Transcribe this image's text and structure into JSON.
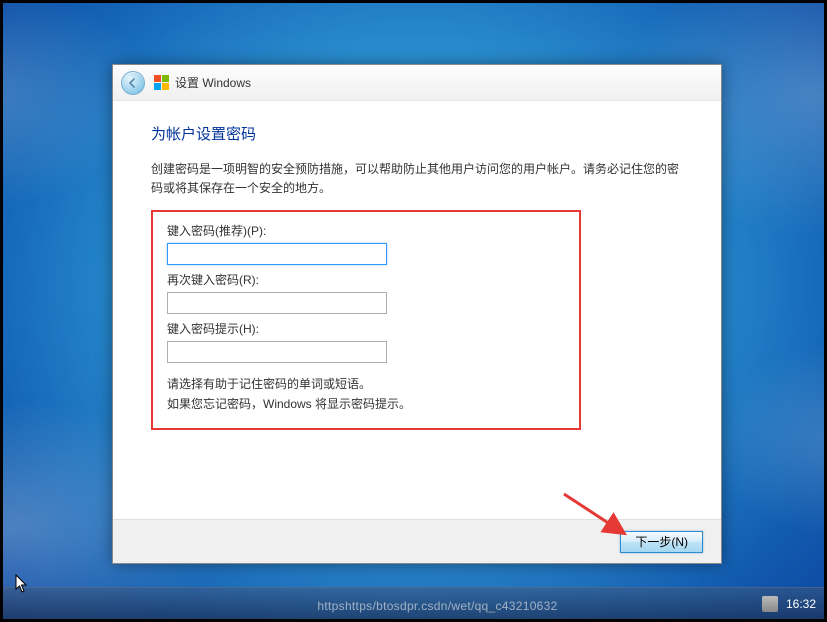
{
  "header": {
    "title": "设置 Windows"
  },
  "main": {
    "title": "为帐户设置密码",
    "description": "创建密码是一项明智的安全预防措施，可以帮助防止其他用户访问您的用户帐户。请务必记住您的密码或将其保存在一个安全的地方。",
    "password_label": "键入密码(推荐)(P):",
    "password_value": "",
    "confirm_label": "再次键入密码(R):",
    "confirm_value": "",
    "hint_label": "键入密码提示(H):",
    "hint_value": "",
    "help_line1": "请选择有助于记住密码的单词或短语。",
    "help_line2": "如果您忘记密码，Windows 将显示密码提示。"
  },
  "footer": {
    "next_label": "下一步(N)"
  },
  "taskbar": {
    "watermark": "httpshttps/btosdpr.csdn/wet/qq_c43210632",
    "clock": "16:32"
  }
}
